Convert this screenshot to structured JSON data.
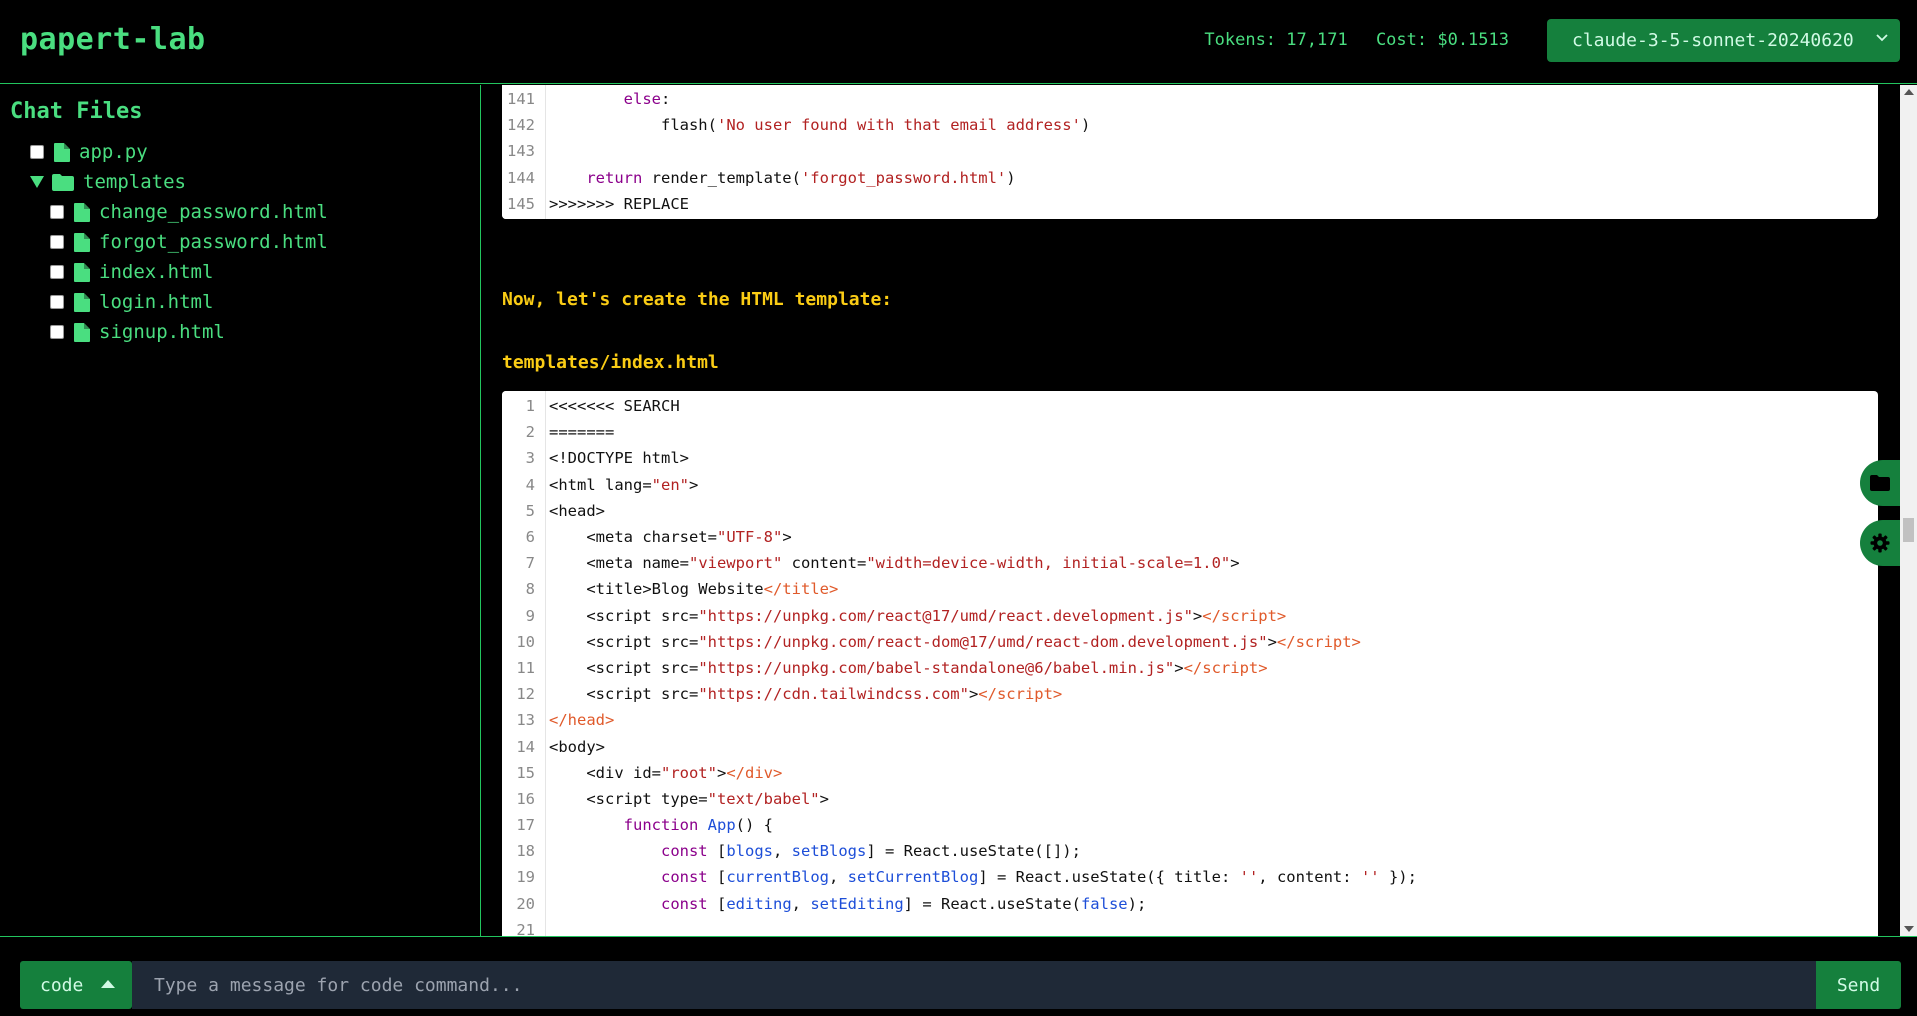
{
  "header": {
    "app_title": "papert-lab",
    "tokens": "Tokens: 17,171",
    "cost": "Cost: $0.1513",
    "model": "claude-3-5-sonnet-20240620"
  },
  "sidebar": {
    "title": "Chat Files",
    "tree": [
      {
        "type": "file",
        "label": "app.py",
        "indent": 0,
        "checked": false
      },
      {
        "type": "folder",
        "label": "templates",
        "indent": 0,
        "expanded": true
      },
      {
        "type": "file",
        "label": "change_password.html",
        "indent": 1,
        "checked": false
      },
      {
        "type": "file",
        "label": "forgot_password.html",
        "indent": 1,
        "checked": false
      },
      {
        "type": "file",
        "label": "index.html",
        "indent": 1,
        "checked": false
      },
      {
        "type": "file",
        "label": "login.html",
        "indent": 1,
        "checked": false
      },
      {
        "type": "file",
        "label": "signup.html",
        "indent": 1,
        "checked": false
      }
    ]
  },
  "main": {
    "top_block": [
      {
        "n": "141",
        "html": "        <span class='k'>else</span>:"
      },
      {
        "n": "142",
        "html": "            flash(<span class='s'>'No user found with that email address'</span>)"
      },
      {
        "n": "143",
        "html": ""
      },
      {
        "n": "144",
        "html": "    <span class='k'>return</span> render_template(<span class='s'>'forgot_password.html'</span>)"
      },
      {
        "n": "145",
        "html": "&gt;&gt;&gt;&gt;&gt;&gt;&gt; REPLACE"
      }
    ],
    "intro_text": "Now, let's create the HTML template:",
    "file_label": "templates/index.html",
    "bottom_block": [
      {
        "n": "1",
        "html": "&lt;&lt;&lt;&lt;&lt;&lt;&lt; SEARCH"
      },
      {
        "n": "2",
        "html": "======="
      },
      {
        "n": "3",
        "html": "&lt;!DOCTYPE html&gt;"
      },
      {
        "n": "4",
        "html": "&lt;html lang=<span class='s'>\"en\"</span>&gt;"
      },
      {
        "n": "5",
        "html": "&lt;head&gt;"
      },
      {
        "n": "6",
        "html": "    &lt;meta charset=<span class='s'>\"UTF-8\"</span>&gt;"
      },
      {
        "n": "7",
        "html": "    &lt;meta name=<span class='s'>\"viewport\"</span> content=<span class='s'>\"width=device-width, initial-scale=1.0\"</span>&gt;"
      },
      {
        "n": "8",
        "html": "    &lt;title&gt;Blog Website<span class='t'>&lt;/title&gt;</span>"
      },
      {
        "n": "9",
        "html": "    &lt;script src=<span class='s'>\"https://unpkg.com/react@17/umd/react.development.js\"</span>&gt;<span class='t'>&lt;/script&gt;</span>"
      },
      {
        "n": "10",
        "html": "    &lt;script src=<span class='s'>\"https://unpkg.com/react-dom@17/umd/react-dom.development.js\"</span>&gt;<span class='t'>&lt;/script&gt;</span>"
      },
      {
        "n": "11",
        "html": "    &lt;script src=<span class='s'>\"https://unpkg.com/babel-standalone@6/babel.min.js\"</span>&gt;<span class='t'>&lt;/script&gt;</span>"
      },
      {
        "n": "12",
        "html": "    &lt;script src=<span class='s'>\"https://cdn.tailwindcss.com\"</span>&gt;<span class='t'>&lt;/script&gt;</span>"
      },
      {
        "n": "13",
        "html": "<span class='t'>&lt;/head&gt;</span>"
      },
      {
        "n": "14",
        "html": "&lt;body&gt;"
      },
      {
        "n": "15",
        "html": "    &lt;div id=<span class='s'>\"root\"</span>&gt;<span class='t'>&lt;/div&gt;</span>"
      },
      {
        "n": "16",
        "html": "    &lt;script type=<span class='s'>\"text/babel\"</span>&gt;"
      },
      {
        "n": "17",
        "html": "        <span class='k'>function</span> <span class='f'>App</span>() {"
      },
      {
        "n": "18",
        "html": "            <span class='k'>const</span> [<span class='v'>blogs</span>, <span class='v'>setBlogs</span>] = React.useState([]);"
      },
      {
        "n": "19",
        "html": "            <span class='k'>const</span> [<span class='v'>currentBlog</span>, <span class='v'>setCurrentBlog</span>] = React.useState({ title: <span class='s'>''</span>, content: <span class='s'>''</span> });"
      },
      {
        "n": "20",
        "html": "            <span class='k'>const</span> [<span class='v'>editing</span>, <span class='v'>setEditing</span>] = React.useState(<span class='v'>false</span>);"
      },
      {
        "n": "21",
        "html": ""
      }
    ]
  },
  "footer": {
    "mode_label": "code",
    "input_placeholder": "Type a message for code command...",
    "send_label": "Send"
  },
  "colors": {
    "accent": "#15803d",
    "text_green": "#4ade80",
    "highlight_yellow": "#facc15"
  }
}
